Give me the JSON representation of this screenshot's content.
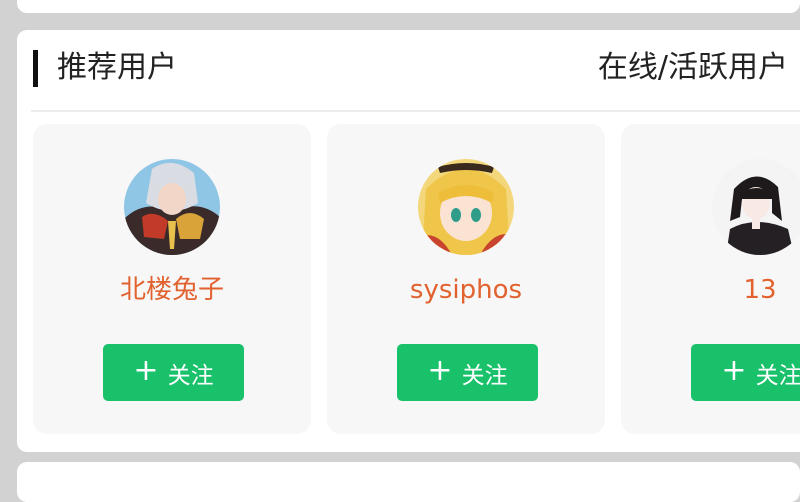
{
  "section": {
    "title": "推荐用户",
    "right_label": "在线/活跃用户"
  },
  "users": [
    {
      "name": "北楼兔子",
      "follow_label": "关注",
      "avatar": "anime-warrior-avatar-icon"
    },
    {
      "name": "sysiphos",
      "follow_label": "关注",
      "avatar": "anime-blonde-girl-avatar-icon"
    },
    {
      "name": "13",
      "follow_label": "关注",
      "avatar": "anime-dark-hair-girl-avatar-icon"
    }
  ],
  "colors": {
    "username": "#e2622f",
    "follow_button": "#19c16b",
    "accent_bar": "#111111"
  }
}
